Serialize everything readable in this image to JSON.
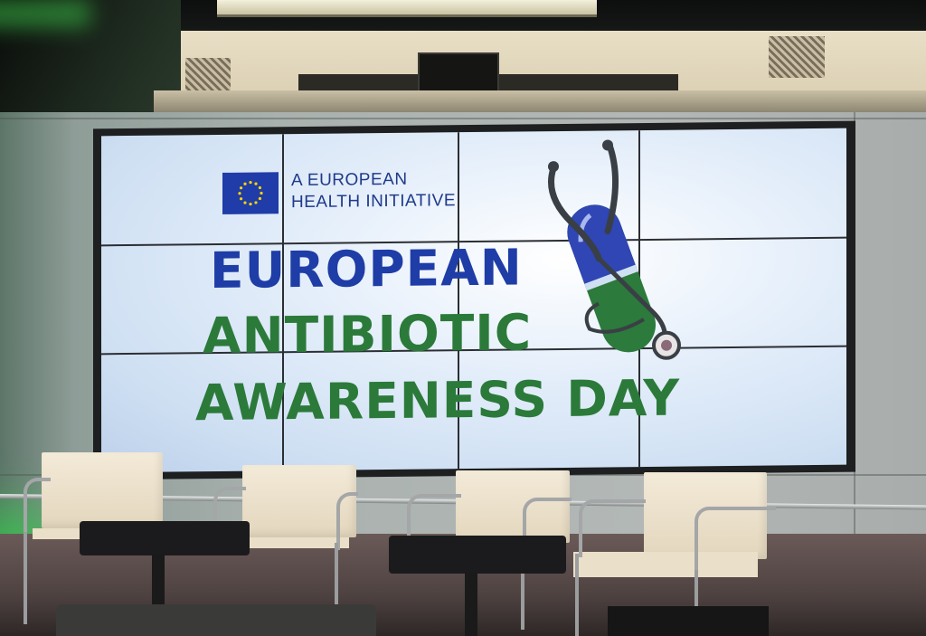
{
  "screen": {
    "initiative_line1": "A EUROPEAN",
    "initiative_line2": "HEALTH INITIATIVE",
    "title_line1": "EUROPEAN",
    "title_line2": "ANTIBIOTIC",
    "title_line3": "AWARENESS DAY"
  },
  "colors": {
    "eu_blue": "#1f3da6",
    "green": "#2b7a3a",
    "flag_star": "#ffd400"
  },
  "icons": {
    "flag": "eu-flag-icon",
    "logo": "stethoscope-capsule-logo"
  }
}
